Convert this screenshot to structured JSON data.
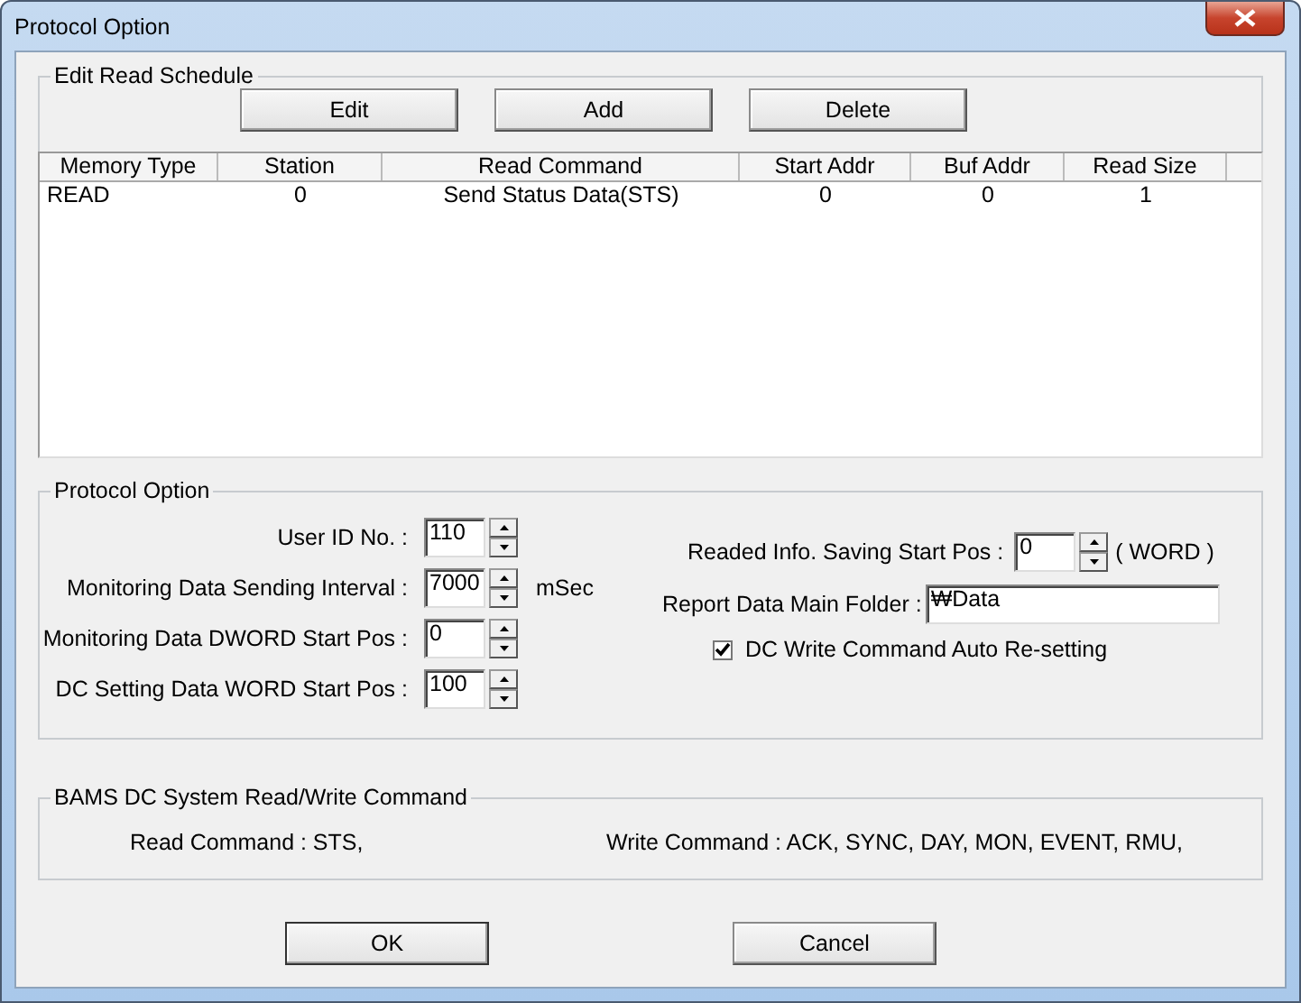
{
  "window": {
    "title": "Protocol Option"
  },
  "schedule": {
    "title": "Edit Read Schedule",
    "buttons": [
      "Edit",
      "Add",
      "Delete"
    ],
    "columns": [
      "Memory Type",
      "Station",
      "Read Command",
      "Start Addr",
      "Buf Addr",
      "Read Size"
    ],
    "rows": [
      [
        "READ",
        "0",
        "Send Status Data(STS)",
        "0",
        "0",
        "1"
      ]
    ]
  },
  "protocol": {
    "title": "Protocol Option",
    "left_fields": [
      {
        "label": "User ID No. :",
        "value": "110"
      },
      {
        "label": "Monitoring Data Sending Interval :",
        "value": "7000",
        "unit": "mSec"
      },
      {
        "label": "Monitoring Data DWORD Start Pos :",
        "value": "0"
      },
      {
        "label": "DC Setting Data WORD Start Pos :",
        "value": "100"
      }
    ],
    "saving_pos": {
      "label": "Readed Info. Saving Start Pos :",
      "value": "0",
      "unit": "( WORD )"
    },
    "folder": {
      "label": "Report Data Main Folder :",
      "value": "₩Data"
    },
    "auto_reset": {
      "label": "DC Write Command Auto Re-setting",
      "checked": true
    }
  },
  "commands": {
    "title": "BAMS DC System Read/Write Command",
    "read": "Read Command : STS,",
    "write": "Write Command : ACK, SYNC, DAY, MON, EVENT, RMU,"
  },
  "buttons": [
    "OK",
    "Cancel"
  ]
}
